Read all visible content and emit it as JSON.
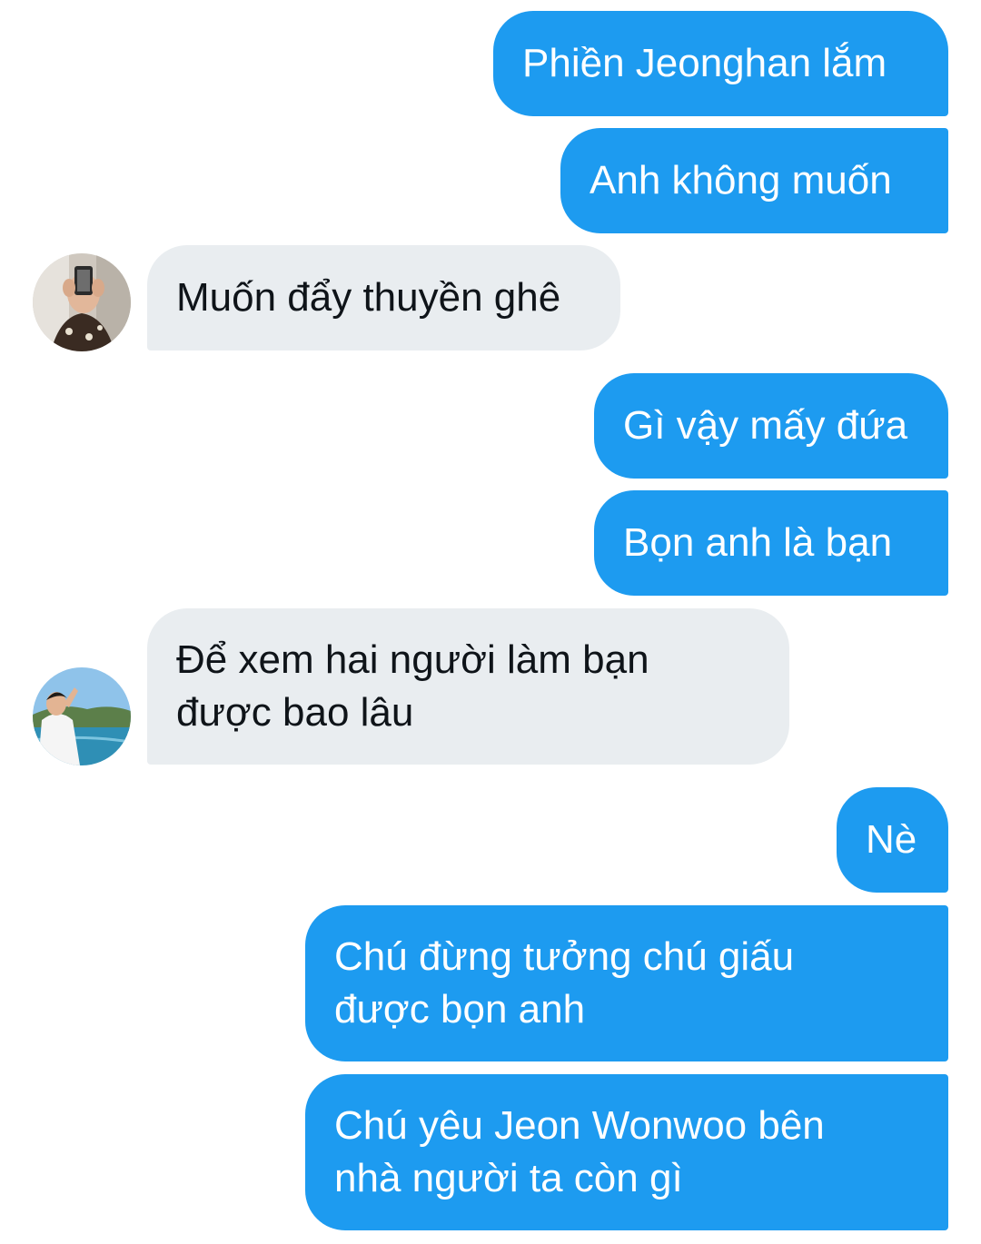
{
  "conversation": {
    "messages": [
      {
        "sender": "me",
        "text": "Phiền Jeonghan lắm"
      },
      {
        "sender": "me",
        "text": "Anh không muốn"
      },
      {
        "sender": "other",
        "avatar": "avatar-selfie",
        "text": "Muốn đẩy thuyền ghê"
      },
      {
        "sender": "me",
        "text": "Gì vậy mấy đứa"
      },
      {
        "sender": "me",
        "text": "Bọn anh là bạn"
      },
      {
        "sender": "other",
        "avatar": "avatar-seaside",
        "text": "Để xem hai người làm bạn\nđược bao lâu"
      },
      {
        "sender": "me",
        "text": "Nè"
      },
      {
        "sender": "me",
        "text": "Chú đừng tưởng chú giấu\nđược bọn anh"
      },
      {
        "sender": "me",
        "text": "Chú yêu Jeon Wonwoo bên\nnhà người ta còn gì"
      }
    ]
  },
  "colors": {
    "outgoing_bubble": "#1d9bf0",
    "outgoing_text": "#ffffff",
    "incoming_bubble": "#e9edf0",
    "incoming_text": "#0f1419"
  }
}
